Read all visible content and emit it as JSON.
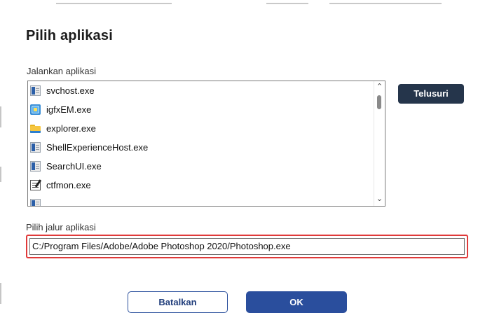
{
  "dialog": {
    "title": "Pilih aplikasi",
    "run_label": "Jalankan aplikasi",
    "browse_label": "Telusuri",
    "path_label": "Pilih jalur aplikasi",
    "path_value": "C:/Program Files/Adobe/Adobe Photoshop 2020/Photoshop.exe",
    "cancel_label": "Batalkan",
    "ok_label": "OK"
  },
  "apps": [
    {
      "name": "svchost.exe",
      "icon": "window-icon"
    },
    {
      "name": "igfxEM.exe",
      "icon": "intel-graphics-icon"
    },
    {
      "name": "explorer.exe",
      "icon": "folder-icon"
    },
    {
      "name": "ShellExperienceHost.exe",
      "icon": "window-icon"
    },
    {
      "name": "SearchUI.exe",
      "icon": "window-icon"
    },
    {
      "name": "ctfmon.exe",
      "icon": "notepad-icon"
    },
    {
      "name": "",
      "icon": "window-icon"
    }
  ],
  "colors": {
    "primary": "#2a4e9d",
    "browse_button": "#25354b",
    "highlight_border": "#e03a3a"
  }
}
